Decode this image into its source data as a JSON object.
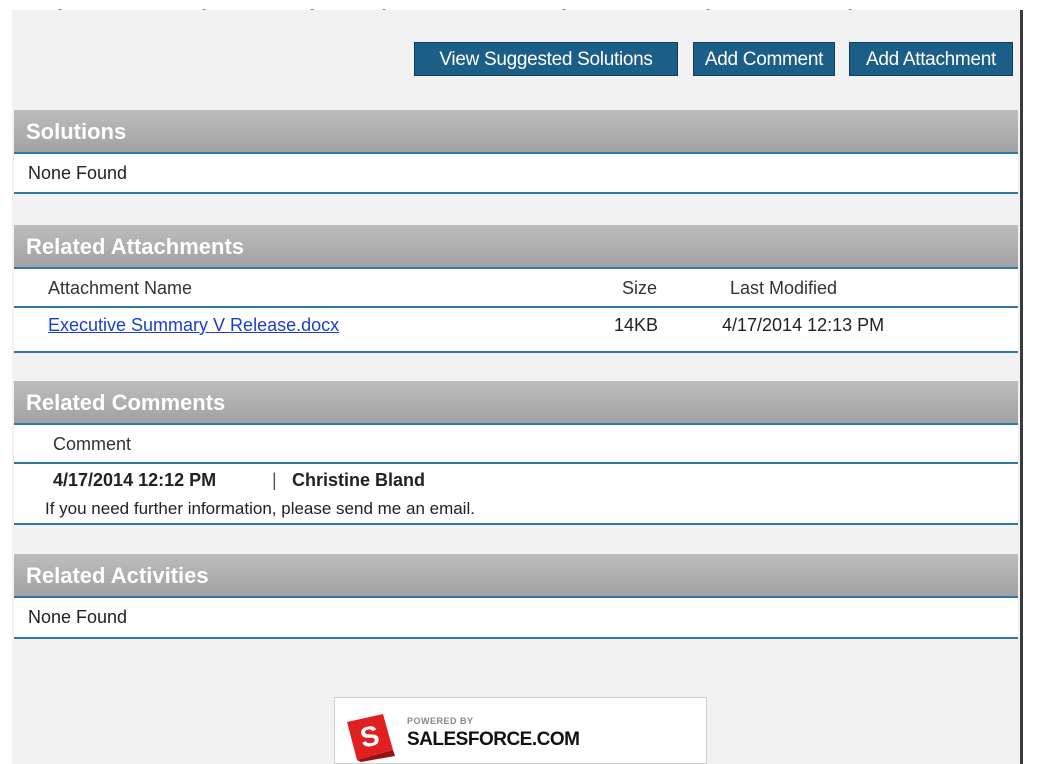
{
  "toolbar": {
    "view_solutions_label": "View Suggested Solutions",
    "add_comment_label": "Add Comment",
    "add_attachment_label": "Add Attachment"
  },
  "solutions": {
    "title": "Solutions",
    "empty_text": "None Found"
  },
  "attachments": {
    "title": "Related Attachments",
    "columns": [
      "Attachment Name",
      "Size",
      "Last Modified"
    ],
    "rows": [
      {
        "name": "Executive Summary V Release.docx",
        "size": "14KB",
        "modified": "4/17/2014 12:13 PM"
      }
    ]
  },
  "comments": {
    "title": "Related Comments",
    "column": "Comment",
    "items": [
      {
        "timestamp": "4/17/2014 12:12 PM",
        "separator": "|",
        "author": "Christine Bland",
        "text": "If you need further information, please send me an email."
      }
    ]
  },
  "activities": {
    "title": "Related Activities",
    "empty_text": "None Found"
  },
  "footer": {
    "powered_by": "POWERED BY",
    "brand": "SALESFORCE.COM",
    "logo_letter": "S"
  },
  "colors": {
    "button_bg": "#1b5e88",
    "header_bg": "#a9a9a9",
    "rule": "#2e78a8",
    "link": "#1a3fcc",
    "logo_red": "#e02020"
  }
}
